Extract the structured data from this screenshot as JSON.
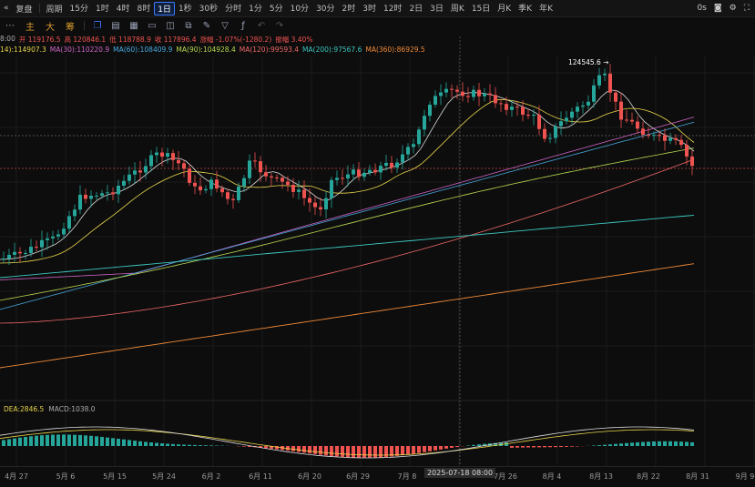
{
  "topbar": {
    "collapse_label": "复盘",
    "period_label": "周期",
    "intervals": [
      "15分",
      "1时",
      "4时",
      "8时",
      "1日",
      "1秒",
      "30秒",
      "分时",
      "1分",
      "5分",
      "10分",
      "30分",
      "2时",
      "3时",
      "12时",
      "2日",
      "3日",
      "周K",
      "15日",
      "月K",
      "季K",
      "年K"
    ],
    "active_interval": "1日",
    "right_label": "0s"
  },
  "toolbar": {
    "main_label": "主",
    "big_label": "大",
    "chip_label": "筹"
  },
  "ohlc": {
    "time": "8:00",
    "open": "开 119176.5",
    "high": "高 120846.1",
    "low": "低 118788.9",
    "close": "收 117896.4",
    "change": "涨幅 -1.07%(-1280.2)",
    "amplitude": "振幅 3.40%"
  },
  "ma_legend": [
    {
      "label": "14):114907.3",
      "color": "#e8d44a"
    },
    {
      "label": "MA(30):110220.9",
      "color": "#d064c8"
    },
    {
      "label": "MA(60):108409.9",
      "color": "#48a8e0"
    },
    {
      "label": "MA(90):104928.4",
      "color": "#b8d850"
    },
    {
      "label": "MA(120):99593.4",
      "color": "#f06868"
    },
    {
      "label": "MA(200):97567.6",
      "color": "#3cc8c0"
    },
    {
      "label": "MA(360):86929.5",
      "color": "#f08a38"
    }
  ],
  "high_label": "124545.6 →",
  "macd_legend": {
    "dea": "DEA:2846.5",
    "macd": "MACD:1038.0"
  },
  "xaxis": {
    "labels": [
      "4月 27",
      "5月 6",
      "5月 15",
      "5月 24",
      "6月 2",
      "6月 11",
      "6月 20",
      "6月 29",
      "7月 8",
      "7月 26",
      "8月 4",
      "8月 13",
      "8月 22",
      "8月 31",
      "9月 9"
    ],
    "crosshair": "2025-07-18 08:00"
  },
  "colors": {
    "up": "#26a69a",
    "down": "#ef5350",
    "background": "#0d0d0d",
    "active": "#3b78ff"
  }
}
